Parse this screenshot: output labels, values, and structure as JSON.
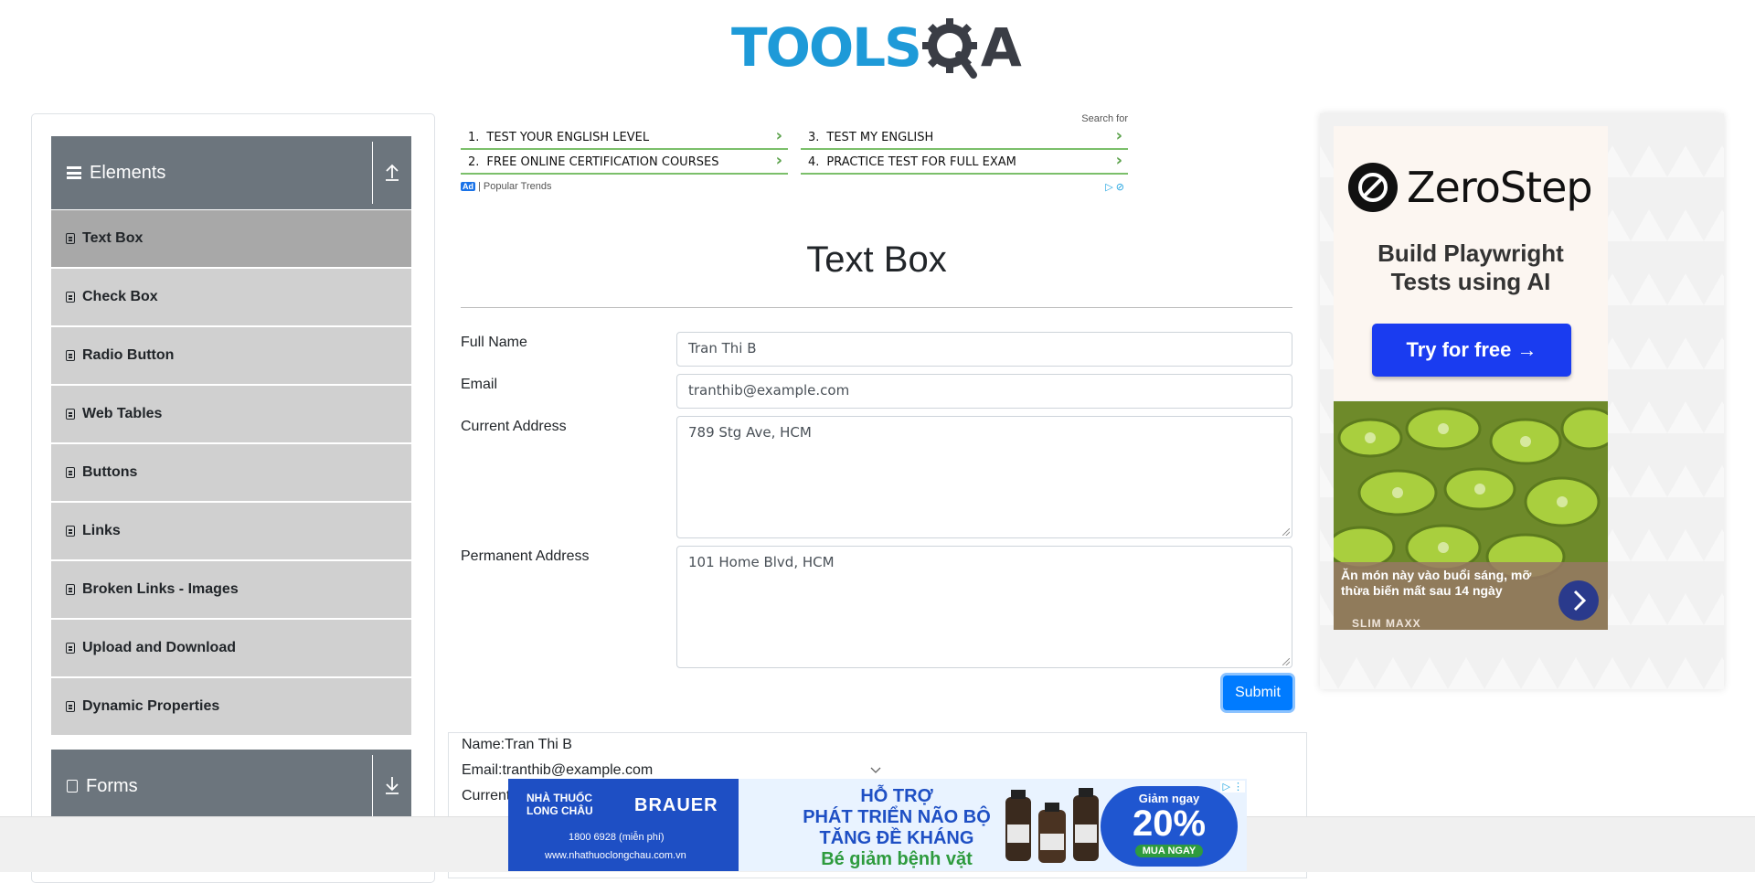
{
  "header": {
    "logo_text": "TOOLS",
    "logo_suffix": "A"
  },
  "sidebar": {
    "groups": [
      {
        "label": "Elements",
        "expanded": true
      },
      {
        "label": "Forms",
        "expanded": false
      }
    ],
    "items": [
      {
        "label": "Text Box",
        "active": true
      },
      {
        "label": "Check Box"
      },
      {
        "label": "Radio Button"
      },
      {
        "label": "Web Tables"
      },
      {
        "label": "Buttons"
      },
      {
        "label": "Links"
      },
      {
        "label": "Broken Links - Images"
      },
      {
        "label": "Upload and Download"
      },
      {
        "label": "Dynamic Properties"
      }
    ]
  },
  "top_ad": {
    "search_for": "Search for",
    "links": [
      {
        "num": "1.",
        "text": "TEST YOUR ENGLISH LEVEL"
      },
      {
        "num": "2.",
        "text": "FREE ONLINE CERTIFICATION COURSES"
      },
      {
        "num": "3.",
        "text": "TEST MY ENGLISH"
      },
      {
        "num": "4.",
        "text": "PRACTICE TEST FOR FULL EXAM"
      }
    ],
    "badge": "Ad",
    "source": "| Popular Trends"
  },
  "form": {
    "title": "Text Box",
    "full_name_label": "Full Name",
    "full_name_value": "Tran Thi B",
    "email_label": "Email",
    "email_value": "tranthib@example.com",
    "current_address_label": "Current Address",
    "current_address_value": "789 Stg Ave, HCM",
    "permanent_address_label": "Permanent Address",
    "permanent_address_value": "101 Home Blvd, HCM",
    "submit_label": "Submit"
  },
  "output": {
    "name": "Name:Tran Thi B",
    "email": "Email:tranthib@example.com",
    "current_partial": "Current"
  },
  "right_ad": {
    "brand": "ZeroStep",
    "tagline_1": "Build Playwright",
    "tagline_2": "Tests using AI",
    "cta": "Try for free →",
    "food_caption": "Ăn món này vào buổi sáng, mỡ thừa biến mất sau 14 ngày",
    "food_brand": "SLIM MAXX"
  },
  "bottom_banner": {
    "store_1": "NHÀ THUỐC",
    "store_2": "LONG CHÂU",
    "brand": "BRAUER",
    "phone": "1800 6928 (miễn phí)",
    "site": "www.nhathuoclongchau.com.vn",
    "headline_1": "HỖ TRỢ",
    "headline_2": "PHÁT TRIỂN NÃO BỘ",
    "headline_3": "TĂNG ĐỀ KHÁNG",
    "headline_4": "Bé giảm bệnh vặt",
    "promo_top": "Giảm ngay",
    "promo_value": "20%",
    "promo_bottom": "MUA NGAY"
  },
  "colors": {
    "primary": "#007bff",
    "sidebar_header": "#6c757d",
    "sidebar_item": "#d0d0d0",
    "sidebar_active": "#a8a8a8",
    "logo_blue": "#1e9ad8"
  }
}
